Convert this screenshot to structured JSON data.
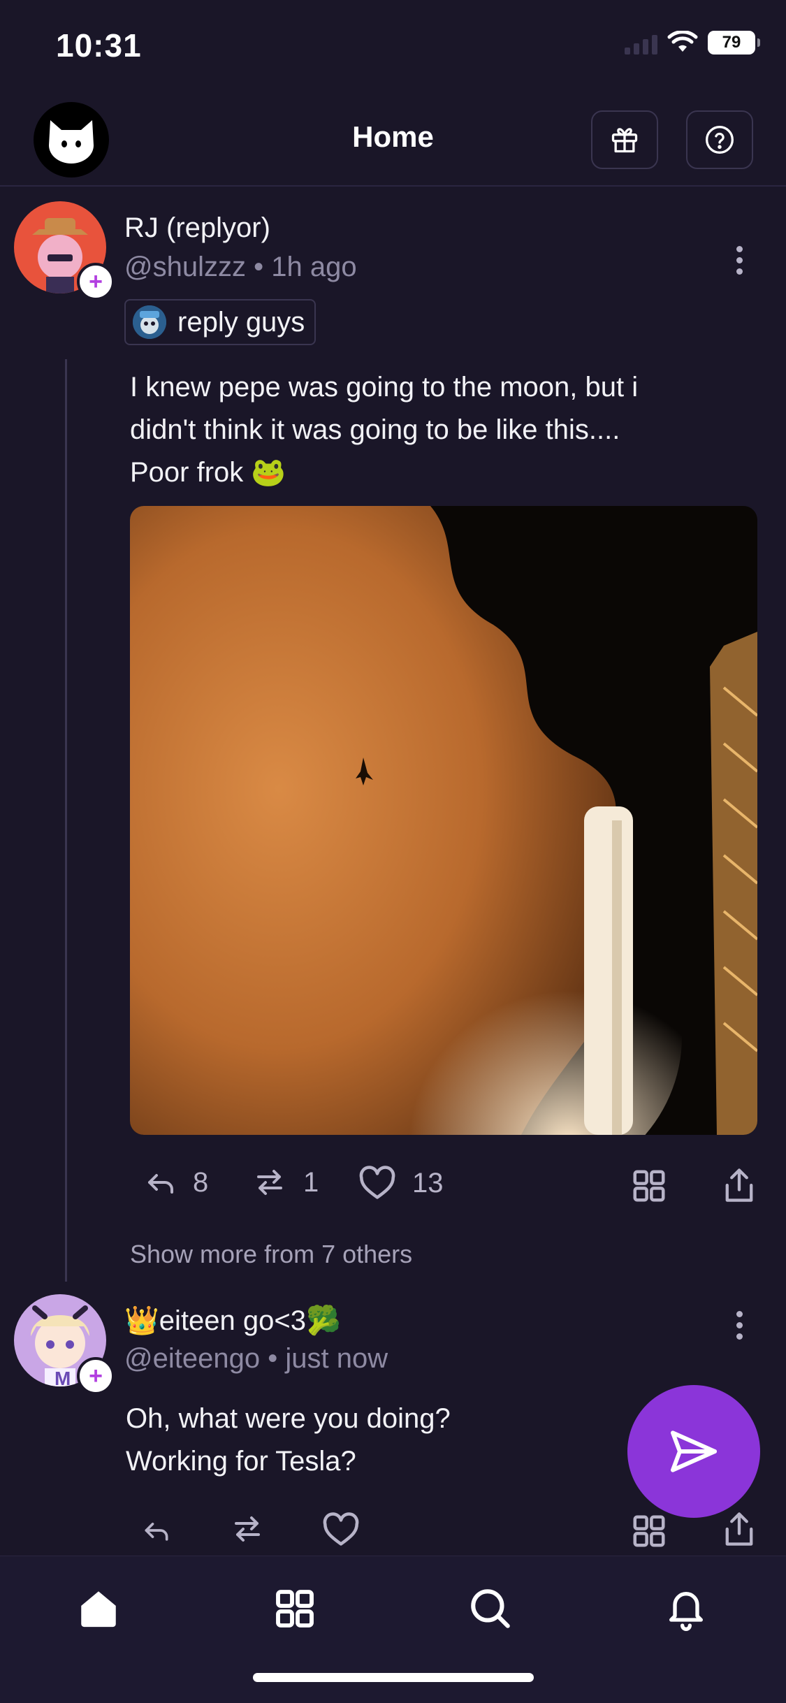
{
  "status_bar": {
    "time": "10:31",
    "battery": "79"
  },
  "header": {
    "title": "Home"
  },
  "post1": {
    "display_name": "RJ (replyor)",
    "handle": "@shulzzz",
    "time": "1h ago",
    "channel": "reply guys",
    "text_lines": [
      "I knew pepe was going to the moon, but i",
      "didn't think it was going to be like this....",
      "Poor frok 🐸"
    ],
    "replies": "8",
    "recasts": "1",
    "likes": "13",
    "show_more": "Show more from 7 others"
  },
  "post2": {
    "display_name": "👑eiteen go<3🥦",
    "handle": "@eiteengo",
    "time": "just now",
    "text_lines": [
      "Oh, what were you doing?",
      "Working for Tesla?"
    ],
    "avatar_letter": "M"
  },
  "icons": {
    "logo": "cat-logo-icon",
    "gift": "gift-icon",
    "help": "help-icon",
    "reply": "reply-icon",
    "recast": "recast-icon",
    "like": "heart-icon",
    "grid": "grid-icon",
    "share": "share-icon",
    "compose": "send-icon",
    "nav": [
      "home-icon",
      "grid-icon",
      "search-icon",
      "bell-icon"
    ]
  },
  "colors": {
    "background": "#1a1628",
    "accent": "#8b35d9",
    "muted_text": "#8e8aa3"
  }
}
